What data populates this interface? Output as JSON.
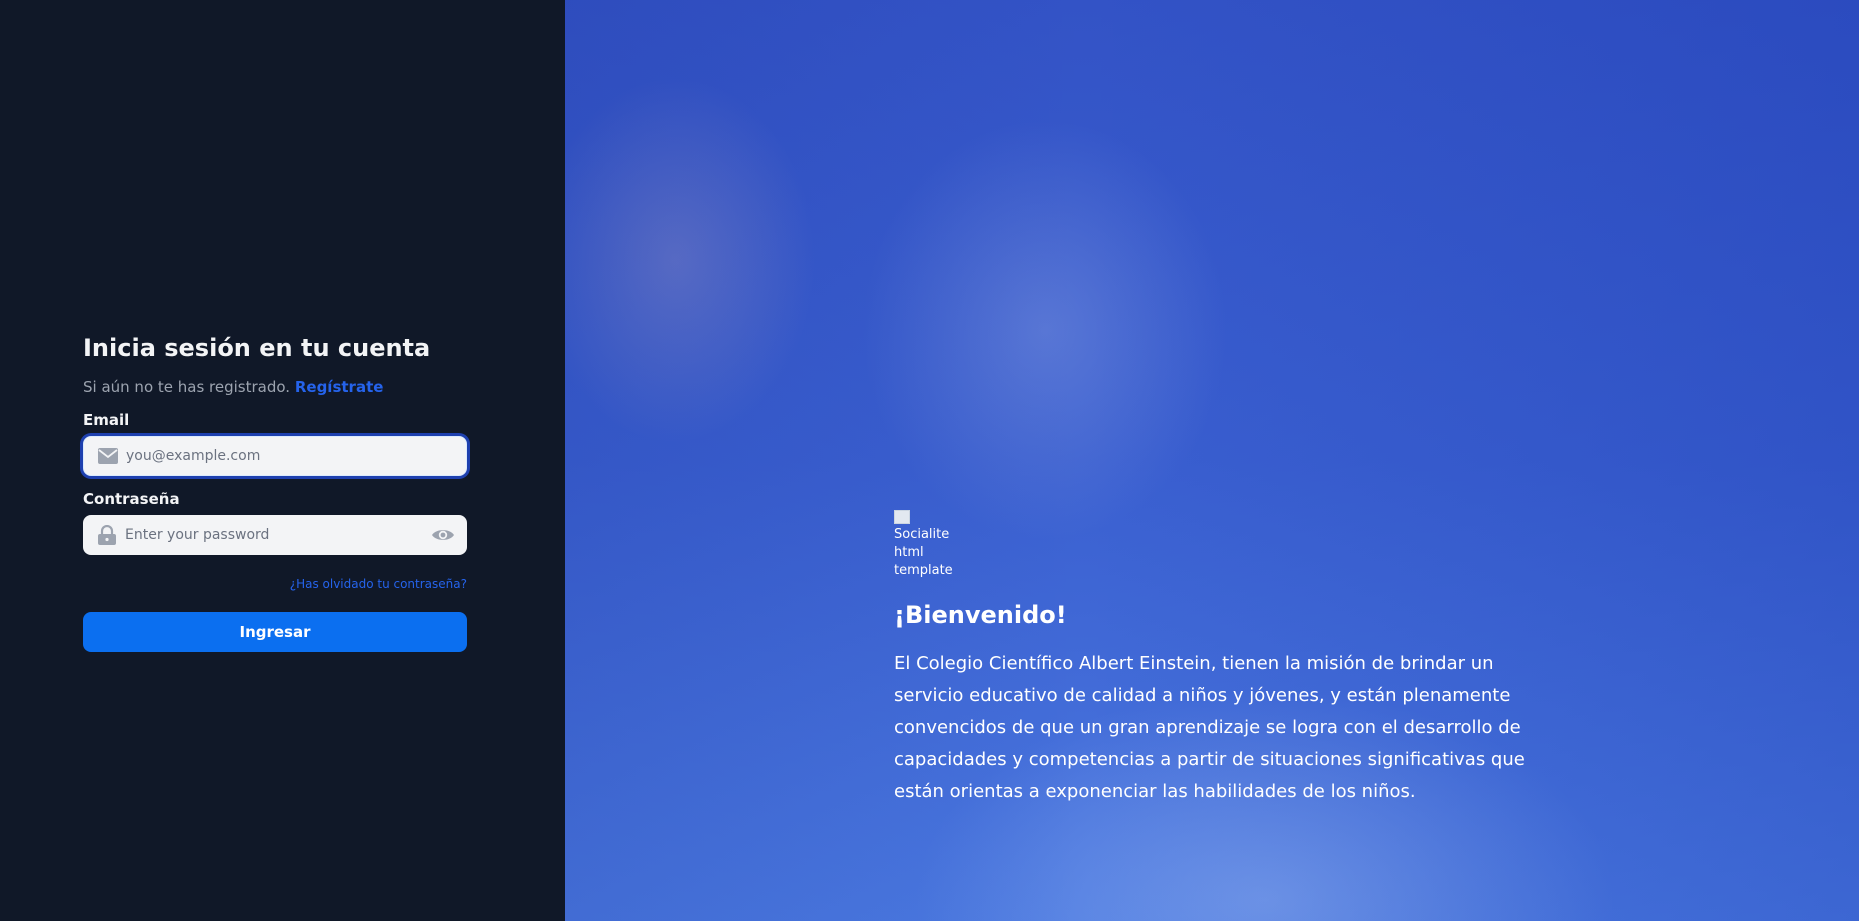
{
  "login": {
    "title": "Inicia sesión en tu cuenta",
    "subtitle_text": "Si aún no te has registrado.",
    "register_link": "Regístrate",
    "email_label": "Email",
    "email_placeholder": "you@example.com",
    "email_value": "",
    "email_icon": "mail-icon",
    "password_label": "Contraseña",
    "password_placeholder": "Enter your password",
    "password_value": "",
    "password_icon": "lock-icon",
    "toggle_icon": "eye-icon",
    "forgot_link": "¿Has olvidado tu contraseña?",
    "submit_label": "Ingresar"
  },
  "hero": {
    "logo_alt": "Socialite html template",
    "welcome": "¡Bienvenido!",
    "description": "El Colegio Científico Albert Einstein, tienen la misión de brindar un servicio educativo de calidad a niños y jóvenes, y están plenamente convencidos de que un gran aprendizaje se logra con el desarrollo de capacidades y competencias a partir de situaciones significativas que están orientas a exponenciar las habilidades de los niños."
  },
  "colors": {
    "left_bg": "#101828",
    "accent": "#0b6ff0",
    "link": "#2563eb",
    "hero_overlay": "#3a5fd0"
  }
}
